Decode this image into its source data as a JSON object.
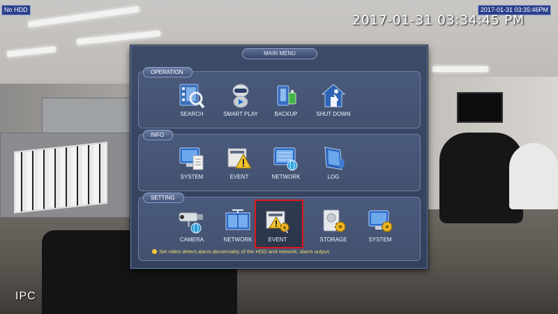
{
  "osd": {
    "hdd_status": "No HDD",
    "top_timestamp": "2017-01-31 03:35:46PM",
    "clock": "2017-01-31 03:34:45 PM",
    "channel_label": "IPC"
  },
  "menu": {
    "title": "MAIN MENU",
    "sections": {
      "operation": {
        "label": "OPERATION",
        "items": [
          {
            "label": "SEARCH",
            "icon": "film-search-icon"
          },
          {
            "label": "SMART PLAY",
            "icon": "robot-play-icon"
          },
          {
            "label": "BACKUP",
            "icon": "usb-backup-icon"
          },
          {
            "label": "SHUT DOWN",
            "icon": "house-exit-icon"
          }
        ]
      },
      "info": {
        "label": "INFO",
        "items": [
          {
            "label": "SYSTEM",
            "icon": "monitor-doc-icon"
          },
          {
            "label": "EVENT",
            "icon": "warning-doc-icon"
          },
          {
            "label": "NETWORK",
            "icon": "globe-monitor-icon"
          },
          {
            "label": "LOG",
            "icon": "log-book-icon"
          }
        ]
      },
      "setting": {
        "label": "SETTING",
        "items": [
          {
            "label": "CAMERA",
            "icon": "camera-globe-icon"
          },
          {
            "label": "NETWORK",
            "icon": "network-panel-icon"
          },
          {
            "label": "EVENT",
            "icon": "event-gear-icon",
            "selected": true
          },
          {
            "label": "STORAGE",
            "icon": "storage-gear-icon"
          },
          {
            "label": "SYSTEM",
            "icon": "system-gear-icon"
          }
        ]
      }
    },
    "hint": "Set video detect,alarm,abnormality of the HDD and network, alarm output."
  },
  "colors": {
    "window_bg": "#3d4b68",
    "selection_border": "#e0161a",
    "hint_text": "#f0d96b",
    "badge_bg": "#2b3f8a"
  }
}
